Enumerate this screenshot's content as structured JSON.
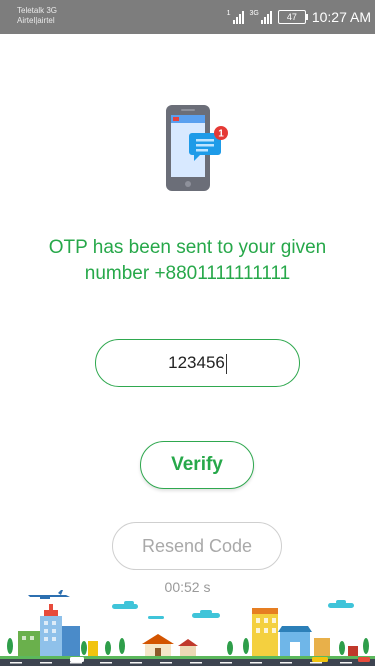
{
  "status_bar": {
    "carrier1": "Teletalk 3G",
    "carrier2": "Airtel|airtel",
    "network": "3G",
    "battery": "47",
    "time": "10:27 AM"
  },
  "otp": {
    "message": "OTP has been sent to your given number +8801111111111",
    "code_value": "123456"
  },
  "buttons": {
    "verify_label": "Verify",
    "resend_label": "Resend Code"
  },
  "timer": "00:52 s",
  "colors": {
    "accent": "#27a84a",
    "status_bar": "#7d7d7d",
    "disabled": "#a9a9a9"
  },
  "icons": [
    "phone-notification-icon",
    "signal-icon",
    "battery-icon",
    "city-skyline-illustration"
  ]
}
